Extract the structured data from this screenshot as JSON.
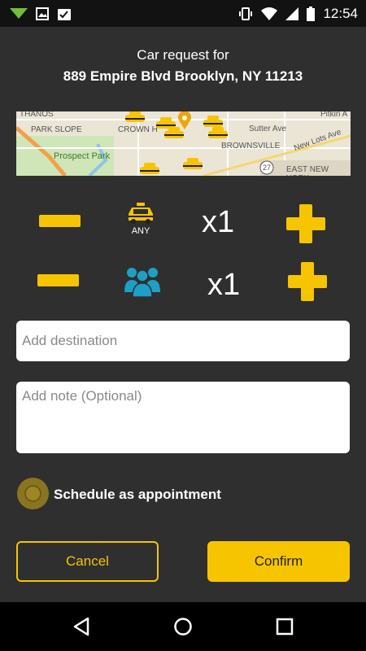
{
  "status_bar": {
    "time": "12:54",
    "icons": [
      "nav-arrow-icon",
      "image-icon",
      "clipboard-check-icon",
      "vibrate-icon",
      "wifi-icon",
      "cell-signal-icon",
      "battery-icon"
    ]
  },
  "header": {
    "title": "Car request for",
    "address": "889 Empire Blvd Brooklyn, NY 11213"
  },
  "map": {
    "labels": [
      "PARK SLOPE",
      "Prospect Park",
      "CROWN H",
      "Sutter Ave",
      "New Lots Ave",
      "BROWNSVILLE",
      "EAST NEW YORK",
      "27",
      "Pitkin A",
      "THANOS"
    ]
  },
  "car_row": {
    "car_type_label": "ANY",
    "count": "x1",
    "icon": "taxi-icon"
  },
  "passenger_row": {
    "count": "x1",
    "icon": "group-icon"
  },
  "form": {
    "destination_placeholder": "Add destination",
    "note_placeholder": "Add note (Optional)",
    "schedule_label": "Schedule as appointment",
    "schedule_checked": false
  },
  "actions": {
    "cancel_label": "Cancel",
    "confirm_label": "Confirm"
  },
  "colors": {
    "accent": "#f7c400",
    "background": "#2f2f2f",
    "passenger_icon": "#1e9fc6"
  },
  "nav_bar": {
    "icons": [
      "back-icon",
      "home-icon",
      "recents-icon"
    ]
  }
}
